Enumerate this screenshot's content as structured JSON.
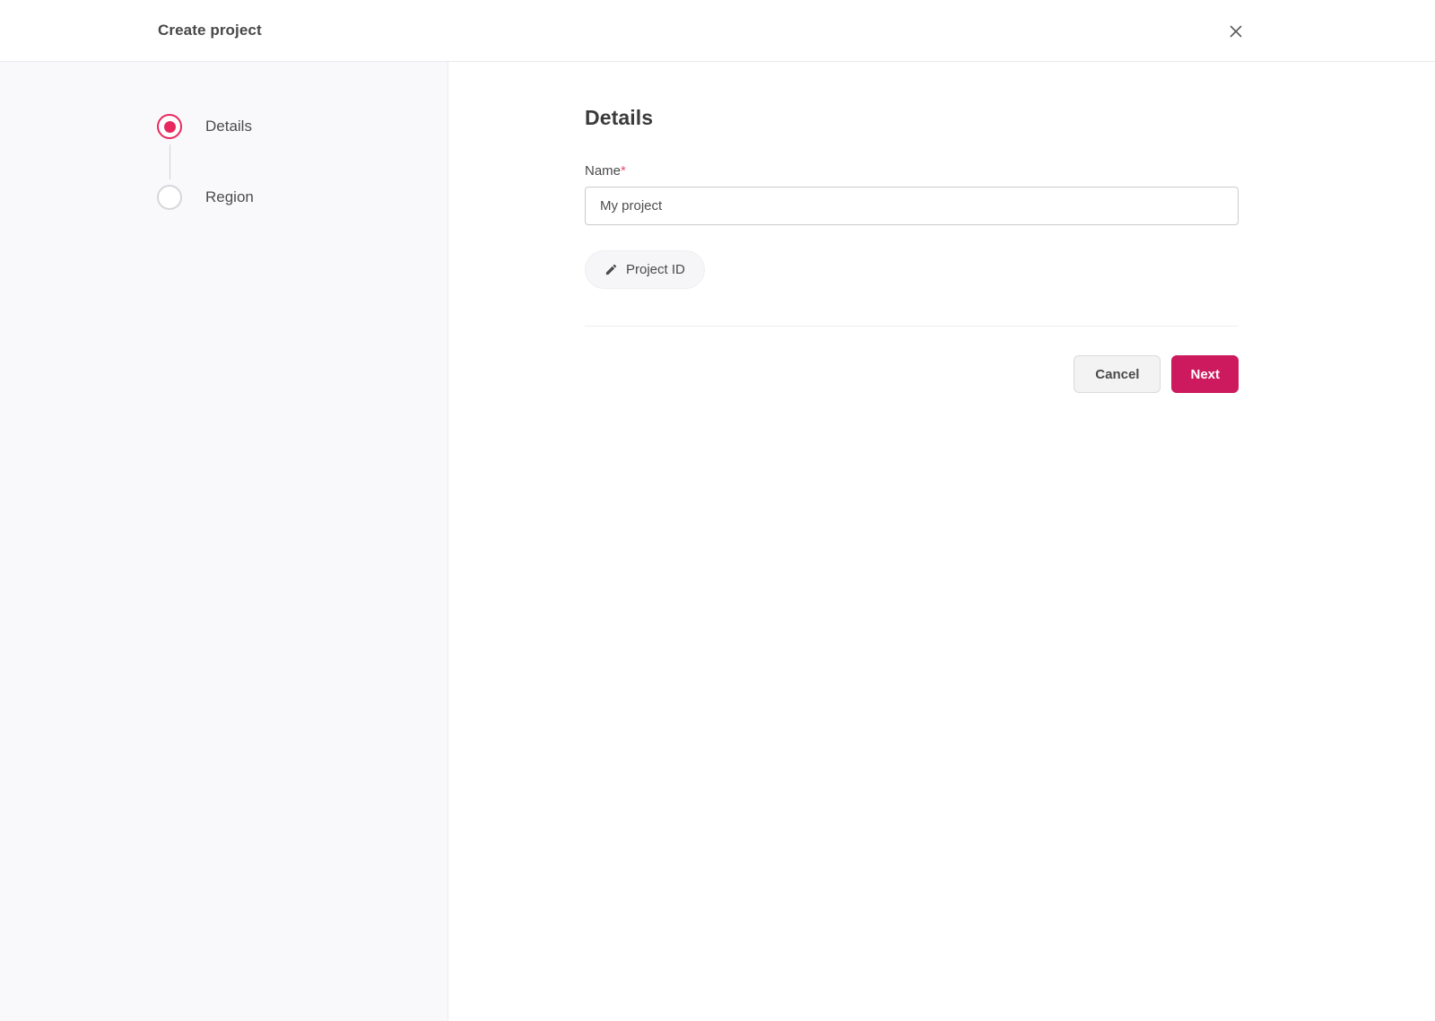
{
  "header": {
    "title": "Create project",
    "close_icon": "close-x"
  },
  "stepper": {
    "steps": [
      {
        "label": "Details",
        "state": "active"
      },
      {
        "label": "Region",
        "state": "inactive"
      }
    ]
  },
  "content": {
    "heading": "Details",
    "name_field": {
      "label": "Name",
      "required_marker": "*",
      "value": "My project"
    },
    "project_id_chip": {
      "label": "Project ID",
      "icon": "pencil-icon"
    }
  },
  "footer": {
    "cancel_label": "Cancel",
    "next_label": "Next"
  },
  "colors": {
    "accent_pink": "#e8295f",
    "primary_button_pink": "#cd1a5e",
    "required_marker_red": "#ef506c",
    "sidebar_background": "#f9f9fb",
    "text_dark": "#4a4a4a"
  }
}
